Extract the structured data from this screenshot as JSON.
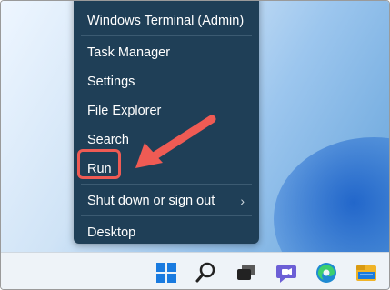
{
  "menu": {
    "items": [
      {
        "label": "Windows Terminal (Admin)"
      },
      {
        "label": "Task Manager"
      },
      {
        "label": "Settings"
      },
      {
        "label": "File Explorer"
      },
      {
        "label": "Search"
      },
      {
        "label": "Run"
      },
      {
        "label": "Shut down or sign out",
        "submenu_icon": "chevron-right-icon"
      },
      {
        "label": "Desktop"
      }
    ],
    "background": "#1f3f57",
    "text_color": "#ffffff"
  },
  "annotation": {
    "highlight_color": "#ef5b54",
    "highlighted_item": "Run"
  },
  "taskbar": {
    "icons": [
      "windows-start-icon",
      "search-icon",
      "task-view-icon",
      "teams-chat-icon",
      "edge-browser-icon",
      "file-explorer-icon"
    ]
  }
}
